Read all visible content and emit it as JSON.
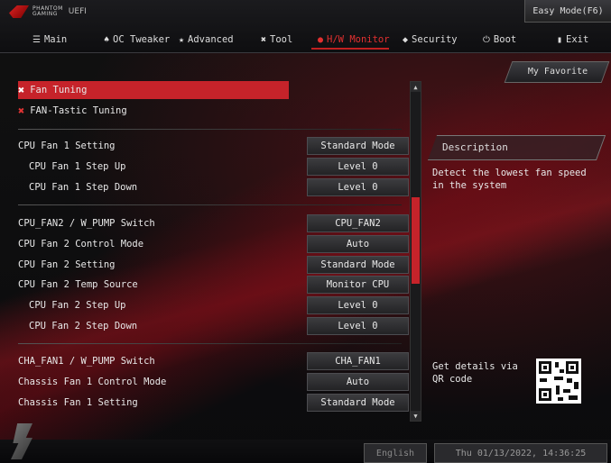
{
  "header": {
    "brand_line1": "PHANTOM",
    "brand_line2": "GAMING",
    "brand_uefi": "UEFI",
    "easy_mode": "Easy Mode(F6)"
  },
  "tabs": [
    {
      "label": "Main",
      "icon": "list-icon"
    },
    {
      "label": "OC Tweaker",
      "icon": "rocket-icon"
    },
    {
      "label": "Advanced",
      "icon": "star-icon"
    },
    {
      "label": "Tool",
      "icon": "tools-icon"
    },
    {
      "label": "H/W Monitor",
      "icon": "monitor-icon",
      "active": true
    },
    {
      "label": "Security",
      "icon": "shield-icon"
    },
    {
      "label": "Boot",
      "icon": "power-icon"
    },
    {
      "label": "Exit",
      "icon": "exit-icon"
    }
  ],
  "my_favorite": "My Favorite",
  "settings": {
    "fan_tuning": "Fan Tuning",
    "fantastic_tuning": "FAN-Tastic Tuning",
    "rows": [
      {
        "label": "CPU Fan 1 Setting",
        "value": "Standard Mode"
      },
      {
        "label": "CPU Fan 1 Step Up",
        "value": "Level 0"
      },
      {
        "label": "CPU Fan 1 Step Down",
        "value": "Level 0"
      },
      {
        "label": "CPU_FAN2 / W_PUMP Switch",
        "value": "CPU_FAN2"
      },
      {
        "label": "CPU Fan 2 Control Mode",
        "value": "Auto"
      },
      {
        "label": "CPU Fan 2 Setting",
        "value": "Standard Mode"
      },
      {
        "label": "CPU Fan 2 Temp Source",
        "value": "Monitor CPU"
      },
      {
        "label": "CPU Fan 2 Step Up",
        "value": "Level 0"
      },
      {
        "label": "CPU Fan 2 Step Down",
        "value": "Level 0"
      },
      {
        "label": "CHA_FAN1 / W_PUMP Switch",
        "value": "CHA_FAN1"
      },
      {
        "label": "Chassis Fan 1 Control Mode",
        "value": "Auto"
      },
      {
        "label": "Chassis Fan 1 Setting",
        "value": "Standard Mode"
      }
    ]
  },
  "description": {
    "title": "Description",
    "text": "Detect the lowest fan speed in the system"
  },
  "qr_text": "Get details via QR code",
  "footer": {
    "language": "English",
    "datetime": "Thu 01/13/2022, 14:36:25"
  },
  "colors": {
    "accent": "#c6232a",
    "background": "#0d0d0f"
  }
}
